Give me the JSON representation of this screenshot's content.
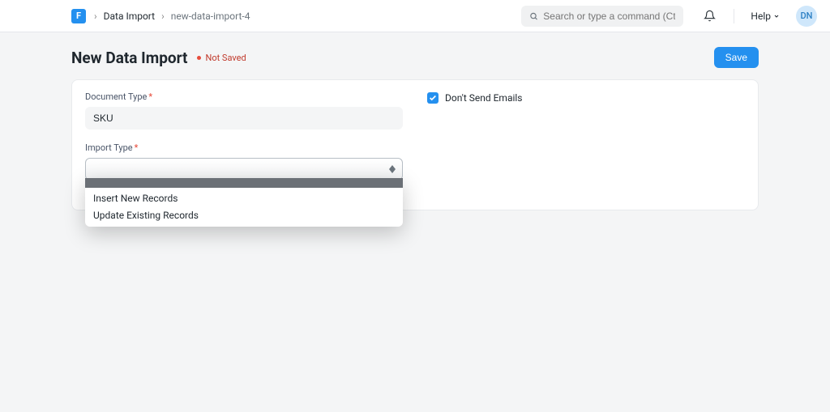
{
  "navbar": {
    "logo_letter": "F",
    "breadcrumb": {
      "parent": "Data Import",
      "current": "new-data-import-4"
    },
    "search_placeholder": "Search or type a command (Ctrl + G)",
    "help_label": "Help",
    "avatar_initials": "DN"
  },
  "page": {
    "title": "New Data Import",
    "status": "Not Saved",
    "save_label": "Save"
  },
  "form": {
    "document_type": {
      "label": "Document Type",
      "value": "SKU"
    },
    "import_type": {
      "label": "Import Type",
      "value": "",
      "options": [
        "Insert New Records",
        "Update Existing Records"
      ]
    },
    "dont_send_emails": {
      "label": "Don't Send Emails",
      "checked": true
    }
  }
}
